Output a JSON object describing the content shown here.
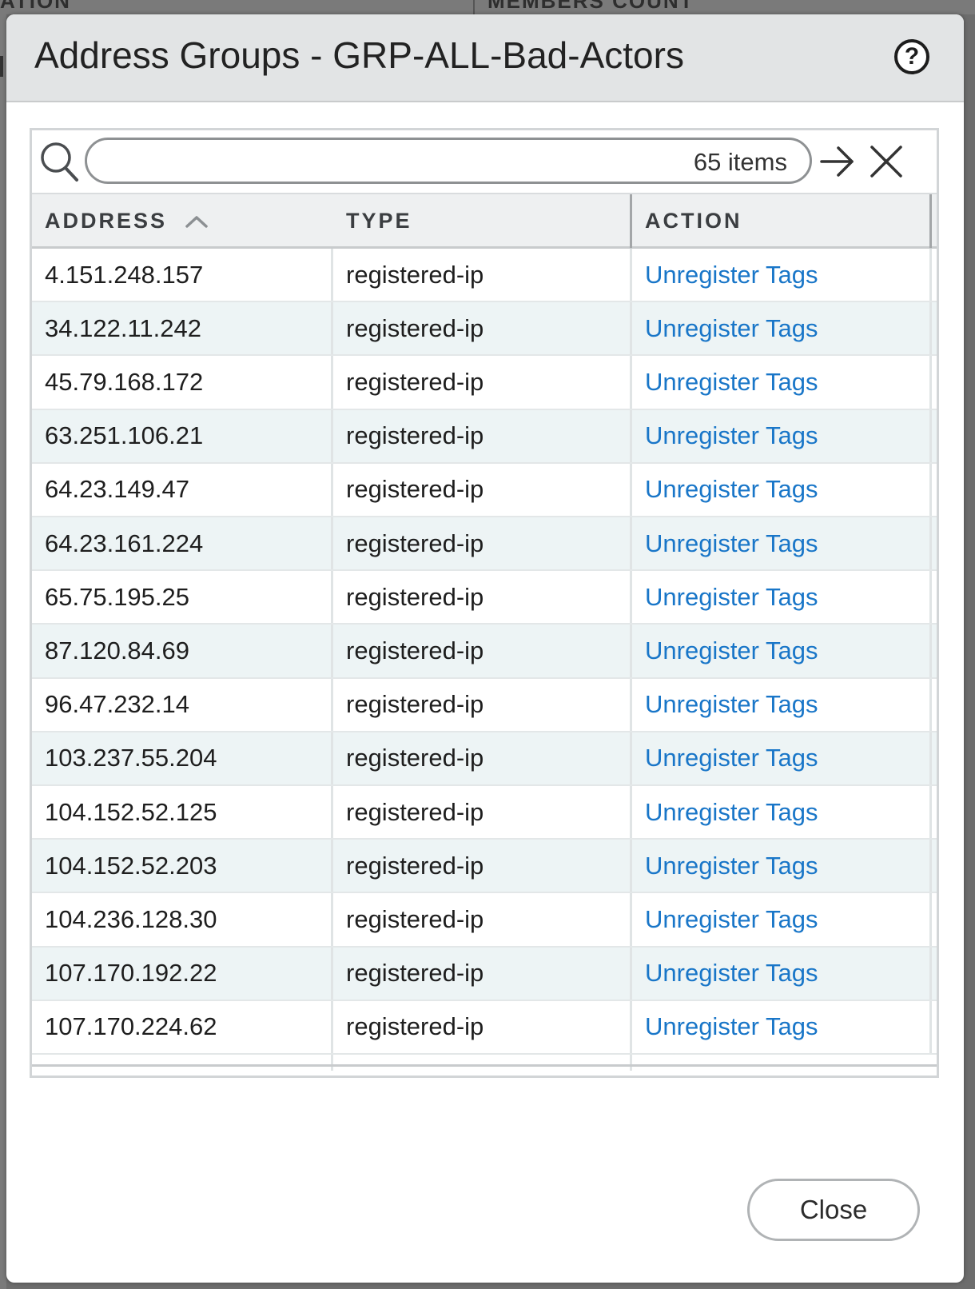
{
  "background": {
    "column_a": "ATION",
    "column_b": "MEMBERS COUNT"
  },
  "dialog": {
    "title": "Address Groups - GRP-ALL-Bad-Actors",
    "help_icon": "question-circle-icon",
    "help_glyph": "?"
  },
  "search": {
    "value": "",
    "items_count": "65 items",
    "apply_icon": "arrow-right-icon",
    "clear_icon": "close-icon"
  },
  "table": {
    "headers": [
      "ADDRESS",
      "TYPE",
      "ACTION"
    ],
    "sort": {
      "column": "ADDRESS",
      "direction": "ascending"
    },
    "rows": [
      {
        "address": "4.151.248.157",
        "type": "registered-ip",
        "action": "Unregister Tags"
      },
      {
        "address": "34.122.11.242",
        "type": "registered-ip",
        "action": "Unregister Tags"
      },
      {
        "address": "45.79.168.172",
        "type": "registered-ip",
        "action": "Unregister Tags"
      },
      {
        "address": "63.251.106.21",
        "type": "registered-ip",
        "action": "Unregister Tags"
      },
      {
        "address": "64.23.149.47",
        "type": "registered-ip",
        "action": "Unregister Tags"
      },
      {
        "address": "64.23.161.224",
        "type": "registered-ip",
        "action": "Unregister Tags"
      },
      {
        "address": "65.75.195.25",
        "type": "registered-ip",
        "action": "Unregister Tags"
      },
      {
        "address": "87.120.84.69",
        "type": "registered-ip",
        "action": "Unregister Tags"
      },
      {
        "address": "96.47.232.14",
        "type": "registered-ip",
        "action": "Unregister Tags"
      },
      {
        "address": "103.237.55.204",
        "type": "registered-ip",
        "action": "Unregister Tags"
      },
      {
        "address": "104.152.52.125",
        "type": "registered-ip",
        "action": "Unregister Tags"
      },
      {
        "address": "104.152.52.203",
        "type": "registered-ip",
        "action": "Unregister Tags"
      },
      {
        "address": "104.236.128.30",
        "type": "registered-ip",
        "action": "Unregister Tags"
      },
      {
        "address": "107.170.192.22",
        "type": "registered-ip",
        "action": "Unregister Tags"
      },
      {
        "address": "107.170.224.62",
        "type": "registered-ip",
        "action": "Unregister Tags"
      }
    ]
  },
  "footer": {
    "close_label": "Close"
  },
  "colors": {
    "link": "#1976c8",
    "header_bg": "#e2e4e5",
    "row_alt": "#edf4f5"
  }
}
